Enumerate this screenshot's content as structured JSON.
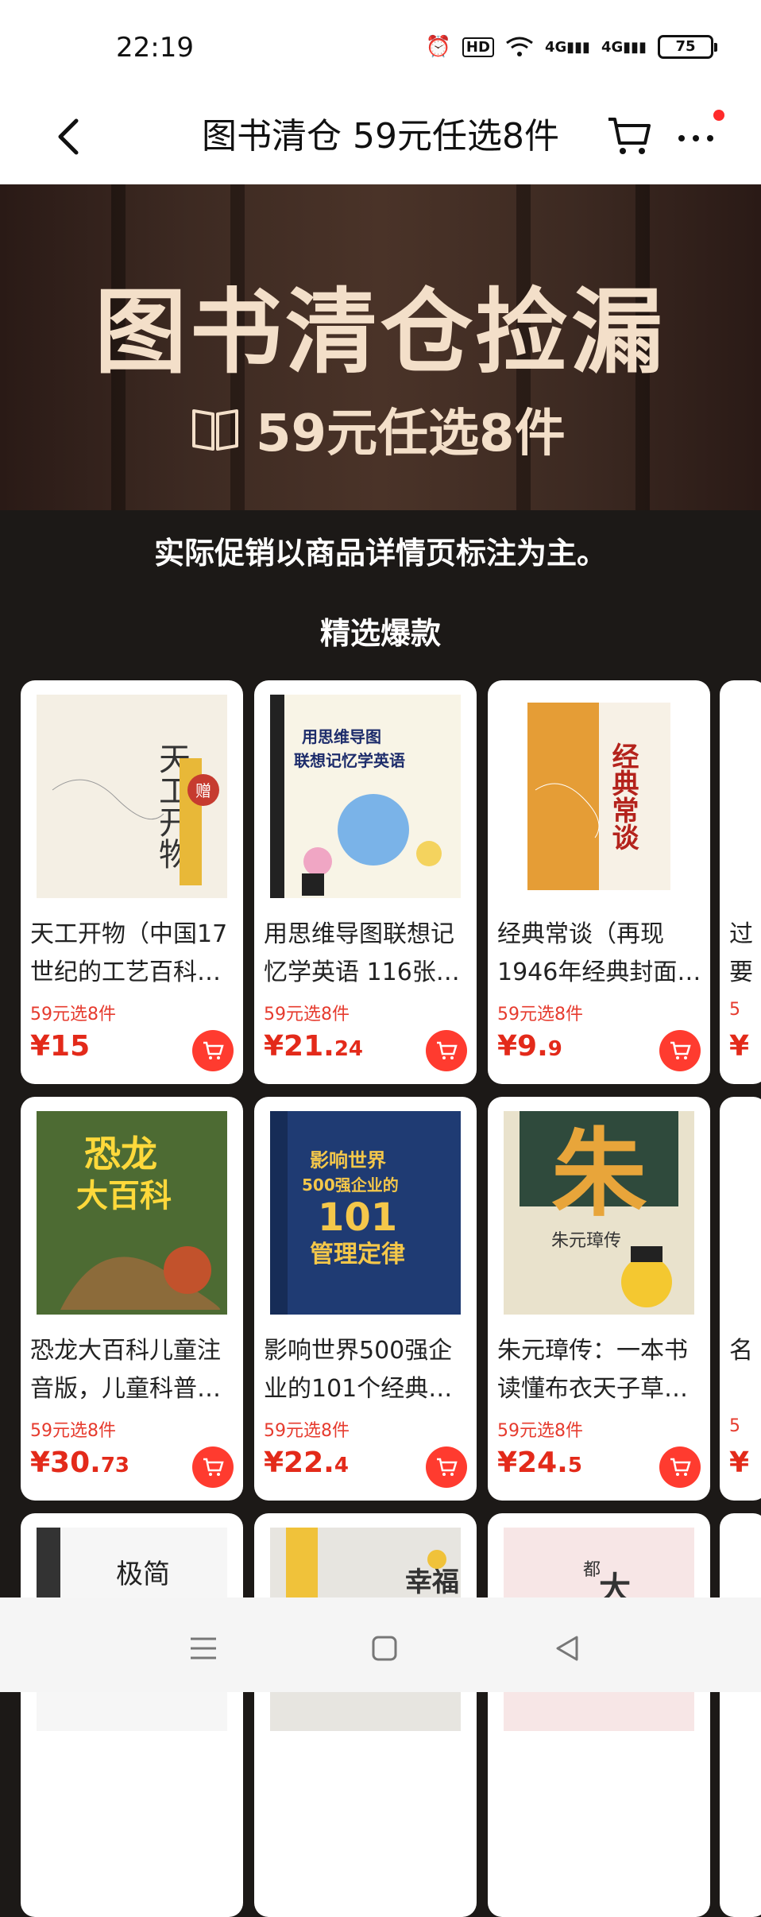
{
  "status_bar": {
    "time": "22:19",
    "battery": "75",
    "hd_badge": "HD",
    "net1": "4G",
    "net2": "4G"
  },
  "nav": {
    "title": "图书清仓 59元任选8件"
  },
  "banner": {
    "title": "图书清仓捡漏",
    "subtitle": "59元任选8件"
  },
  "notice": "实际促销以商品详情页标注为主。",
  "section_title": "精选爆款",
  "products": [
    {
      "title_l1": "天工开物（中国17",
      "title_l2": "世纪的工艺百科…",
      "promo": "59元选8件",
      "price_int": "¥15",
      "price_dec": "",
      "cover_text": "天工开物",
      "cover_bg": "#f4efe4",
      "cover_ink": "#333333"
    },
    {
      "title_l1": "用思维导图联想记",
      "title_l2": "忆学英语 116张…",
      "promo": "59元选8件",
      "price_int": "¥21.",
      "price_dec": "24",
      "cover_text": "用思维导图联想记忆学英语",
      "cover_bg": "#f8f4e6",
      "cover_ink": "#1d2c6b"
    },
    {
      "title_l1": "经典常谈（再现",
      "title_l2": "1946年经典封面…",
      "promo": "59元选8件",
      "price_int": "¥9.",
      "price_dec": "9",
      "cover_text": "经典常谈",
      "cover_bg": "#e59d36",
      "cover_ink": "#b4231c"
    },
    {
      "title_l1": "恐龙大百科儿童注",
      "title_l2": "音版，儿童科普…",
      "promo": "59元选8件",
      "price_int": "¥30.",
      "price_dec": "73",
      "cover_text": "恐龙大百科",
      "cover_bg": "#5a7a3a",
      "cover_ink": "#ffd93b"
    },
    {
      "title_l1": "影响世界500强企",
      "title_l2": "业的101个经典…",
      "promo": "59元选8件",
      "price_int": "¥22.",
      "price_dec": "4",
      "cover_text": "影响世界500强企业的101个管理定律",
      "cover_bg": "#1f3b73",
      "cover_ink": "#f4c74a"
    },
    {
      "title_l1": "朱元璋传：一本书",
      "title_l2": "读懂布衣天子草…",
      "promo": "59元选8件",
      "price_int": "¥24.",
      "price_dec": "5",
      "cover_text": "朱",
      "cover_bg": "#e9e2cc",
      "cover_ink": "#e8a53a"
    },
    {
      "title_l1": "",
      "title_l2": "",
      "promo": "",
      "price_int": "",
      "price_dec": "",
      "cover_text": "极简",
      "cover_bg": "#f6f6f6",
      "cover_ink": "#222222"
    },
    {
      "title_l1": "",
      "title_l2": "",
      "promo": "",
      "price_int": "",
      "price_dec": "",
      "cover_text": "幸福之路",
      "cover_bg": "#e7e5e0",
      "cover_ink": "#333333"
    },
    {
      "title_l1": "",
      "title_l2": "",
      "promo": "",
      "price_int": "",
      "price_dec": "",
      "cover_text": "所有的大人都曾是小孩",
      "cover_bg": "#f7e6e6",
      "cover_ink": "#333333"
    }
  ],
  "peek": {
    "l1": "过",
    "l2": "要",
    "l3": "5",
    "l4": "¥",
    "l5": "名",
    "l6": "5",
    "l7": "¥"
  },
  "bottom_nav": {
    "menu": "menu-icon",
    "home": "home-icon",
    "back": "back-icon"
  }
}
